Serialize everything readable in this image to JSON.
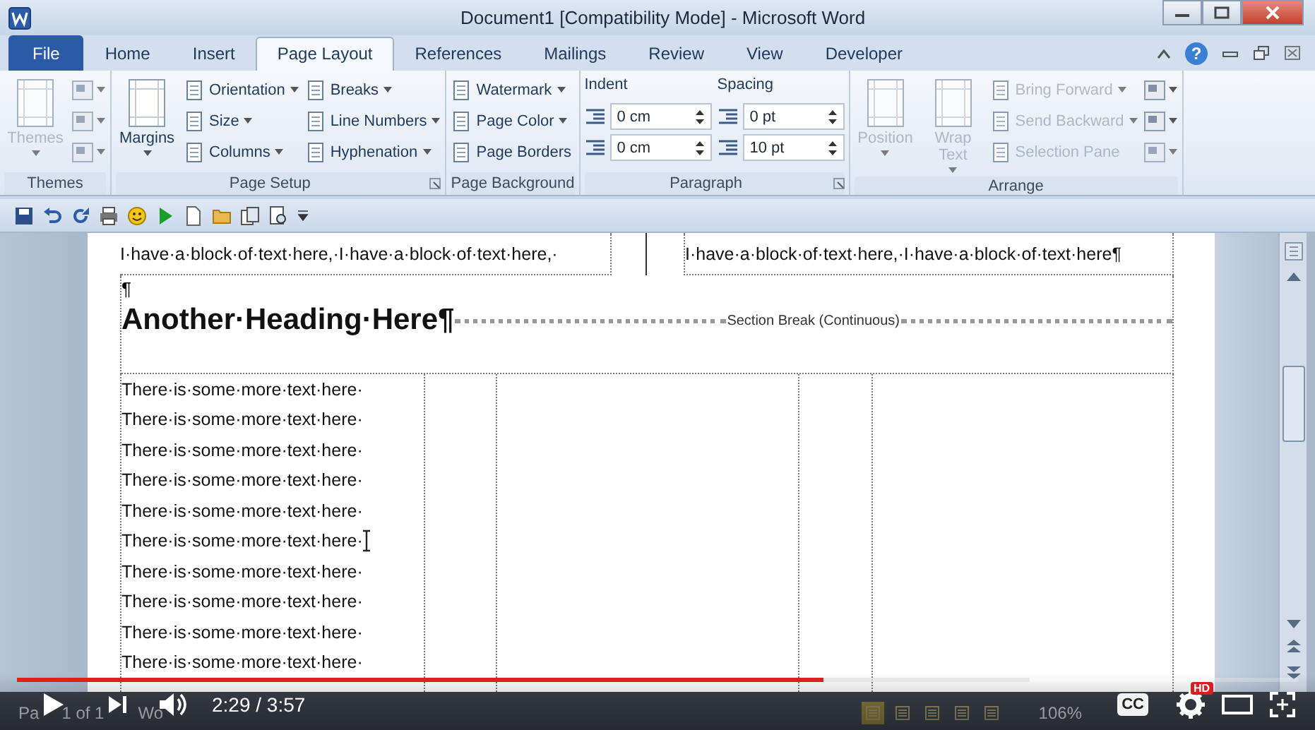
{
  "window": {
    "title": "Document1 [Compatibility Mode] - Microsoft Word",
    "help": "?"
  },
  "tabs": [
    {
      "label": "File",
      "kind": "file",
      "selected": false
    },
    {
      "label": "Home",
      "kind": "tab",
      "selected": false
    },
    {
      "label": "Insert",
      "kind": "tab",
      "selected": false
    },
    {
      "label": "Page Layout",
      "kind": "tab",
      "selected": true
    },
    {
      "label": "References",
      "kind": "tab",
      "selected": false
    },
    {
      "label": "Mailings",
      "kind": "tab",
      "selected": false
    },
    {
      "label": "Review",
      "kind": "tab",
      "selected": false
    },
    {
      "label": "View",
      "kind": "tab",
      "selected": false
    },
    {
      "label": "Developer",
      "kind": "tab",
      "selected": false
    }
  ],
  "ribbon": [
    {
      "label": "Themes",
      "launcher": false,
      "columns": [
        {
          "items": [
            {
              "kind": "large",
              "label": "Themes",
              "disabled": true,
              "dropdown": true
            }
          ]
        },
        {
          "items": [
            {
              "kind": "icon",
              "disabled": true,
              "dropdown": true
            },
            {
              "kind": "icon",
              "disabled": true,
              "dropdown": true
            },
            {
              "kind": "icon",
              "disabled": true,
              "dropdown": true
            }
          ]
        }
      ]
    },
    {
      "label": "Page Setup",
      "launcher": true,
      "columns": [
        {
          "items": [
            {
              "kind": "large",
              "label": "Margins",
              "disabled": false,
              "dropdown": true
            }
          ]
        },
        {
          "items": [
            {
              "kind": "small",
              "label": "Orientation",
              "disabled": false,
              "dropdown": true
            },
            {
              "kind": "small",
              "label": "Size",
              "disabled": false,
              "dropdown": true
            },
            {
              "kind": "small",
              "label": "Columns",
              "disabled": false,
              "dropdown": true
            }
          ]
        },
        {
          "items": [
            {
              "kind": "small",
              "label": "Breaks",
              "disabled": false,
              "dropdown": true
            },
            {
              "kind": "small",
              "label": "Line Numbers",
              "disabled": false,
              "dropdown": true
            },
            {
              "kind": "small",
              "label": "Hyphenation",
              "disabled": false,
              "dropdown": true
            }
          ]
        }
      ]
    },
    {
      "label": "Page Background",
      "launcher": false,
      "columns": [
        {
          "items": [
            {
              "kind": "small",
              "label": "Watermark",
              "disabled": false,
              "dropdown": true
            },
            {
              "kind": "small",
              "label": "Page Color",
              "disabled": false,
              "dropdown": true
            },
            {
              "kind": "small",
              "label": "Page Borders",
              "disabled": false,
              "dropdown": false
            }
          ]
        }
      ]
    },
    {
      "label": "Paragraph",
      "launcher": true,
      "columns": [
        {
          "heading": "Indent",
          "items": [
            {
              "kind": "spin",
              "value": "0 cm",
              "disabled": false
            },
            {
              "kind": "spin",
              "value": "0 cm",
              "disabled": false
            }
          ]
        },
        {
          "heading": "Spacing",
          "items": [
            {
              "kind": "spin",
              "value": "0 pt",
              "disabled": false
            },
            {
              "kind": "spin",
              "value": "10 pt",
              "disabled": false
            }
          ]
        }
      ]
    },
    {
      "label": "Arrange",
      "launcher": false,
      "columns": [
        {
          "items": [
            {
              "kind": "large",
              "label": "Position",
              "disabled": true,
              "dropdown": true
            }
          ]
        },
        {
          "items": [
            {
              "kind": "large",
              "label": "Wrap Text",
              "disabled": true,
              "dropdown": true
            }
          ]
        },
        {
          "items": [
            {
              "kind": "small",
              "label": "Bring Forward",
              "disabled": true,
              "dropdown": true
            },
            {
              "kind": "small",
              "label": "Send Backward",
              "disabled": true,
              "dropdown": true
            },
            {
              "kind": "small",
              "label": "Selection Pane",
              "disabled": true,
              "dropdown": false
            }
          ]
        },
        {
          "items": [
            {
              "kind": "icon",
              "disabled": false,
              "dropdown": true
            },
            {
              "kind": "icon",
              "disabled": false,
              "dropdown": true
            },
            {
              "kind": "icon",
              "disabled": true,
              "dropdown": true
            }
          ]
        }
      ]
    }
  ],
  "document": {
    "top_row": [
      "I·have·a·block·of·text·here,·I·have·a·block·of·text·here,·",
      "I·have·a·block·of·text·here,·I·have·a·block·of·text·here¶"
    ],
    "pilcrow": "¶",
    "heading": "Another·Heading·Here¶",
    "section_break": "Section Break (Continuous)",
    "lines": [
      {
        "text": "There·is·some·more·text·here·",
        "cursor": false
      },
      {
        "text": "There·is·some·more·text·here·",
        "cursor": false
      },
      {
        "text": "There·is·some·more·text·here·",
        "cursor": false
      },
      {
        "text": "There·is·some·more·text·here·",
        "cursor": false
      },
      {
        "text": "There·is·some·more·text·here·",
        "cursor": false
      },
      {
        "text": "There·is·some·more·text·here·",
        "cursor": true
      },
      {
        "text": "There·is·some·more·text·here·",
        "cursor": false
      },
      {
        "text": "There·is·some·more·text·here·",
        "cursor": false
      },
      {
        "text": "There·is·some·more·text·here·",
        "cursor": false
      },
      {
        "text": "There·is·some·more·text·here·",
        "cursor": false
      }
    ]
  },
  "status_bar": {
    "left": [
      "Pa",
      "1 of 1",
      "Wo"
    ],
    "zoom": "106%"
  },
  "player": {
    "level": 0.63,
    "time": "2:29 / 3:57",
    "captions": "CC",
    "quality": "HD"
  }
}
